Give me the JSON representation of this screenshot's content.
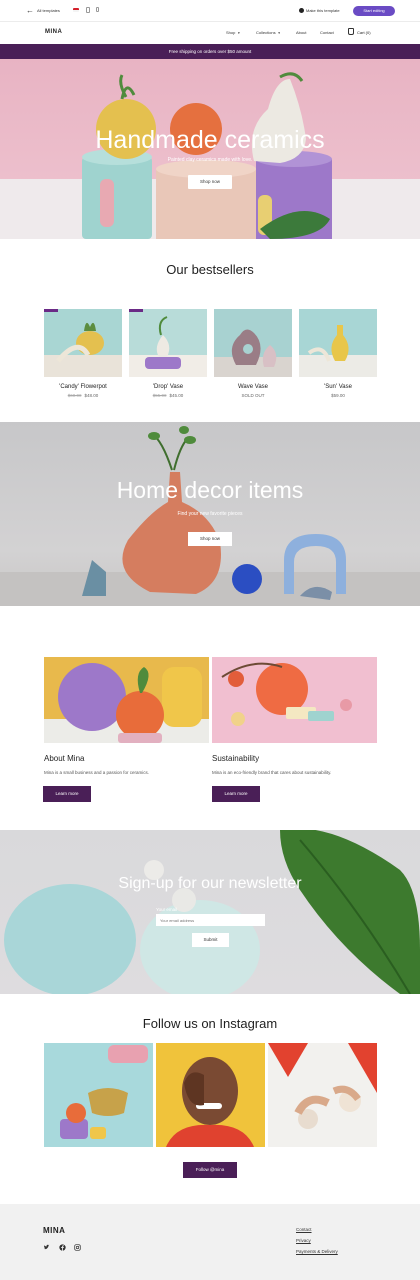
{
  "editor": {
    "back_label": "All templates",
    "status": "Make this template",
    "cta": "Start editing"
  },
  "nav": {
    "logo": "MINA",
    "links": [
      "Shop",
      "Collections",
      "About",
      "Contact"
    ],
    "cart": "Cart (0)"
  },
  "announcement": "Free shipping on orders over $50 amount",
  "hero": {
    "title": "Handmade ceramics",
    "subtitle": "Painted clay ceramics made with love.",
    "button": "Shop now"
  },
  "bestsellers": {
    "title": "Our bestsellers",
    "products": [
      {
        "name": "'Candy' Flowerpot",
        "old_price": "$60.00",
        "price": "$48.00"
      },
      {
        "name": "'Drop' Vase",
        "old_price": "$55.00",
        "price": "$45.00"
      },
      {
        "name": "Wave Vase",
        "old_price": "",
        "price": "SOLD OUT"
      },
      {
        "name": "'Sun' Vase",
        "old_price": "",
        "price": "$59.00"
      }
    ]
  },
  "decor": {
    "title": "Home decor items",
    "subtitle": "Find your new favorite pieces",
    "button": "Shop now"
  },
  "features": [
    {
      "title": "About Mina",
      "text": "Mina is a small business and a passion for ceramics.",
      "button": "Learn more"
    },
    {
      "title": "Sustainability",
      "text": "Mina is an eco-friendly brand that cares about sustainability.",
      "button": "Learn more"
    }
  ],
  "newsletter": {
    "title": "Sign-up for our newsletter",
    "label": "Your email",
    "placeholder": "Your email address",
    "button": "Submit"
  },
  "instagram": {
    "title": "Follow us on Instagram",
    "button": "Follow @mina"
  },
  "footer": {
    "logo": "MINA",
    "links": [
      "Contact",
      "Privacy",
      "Payments & Delivery"
    ]
  },
  "colors": {
    "brand_purple": "#4a1f57",
    "editor_accent": "#6a4bc4"
  }
}
